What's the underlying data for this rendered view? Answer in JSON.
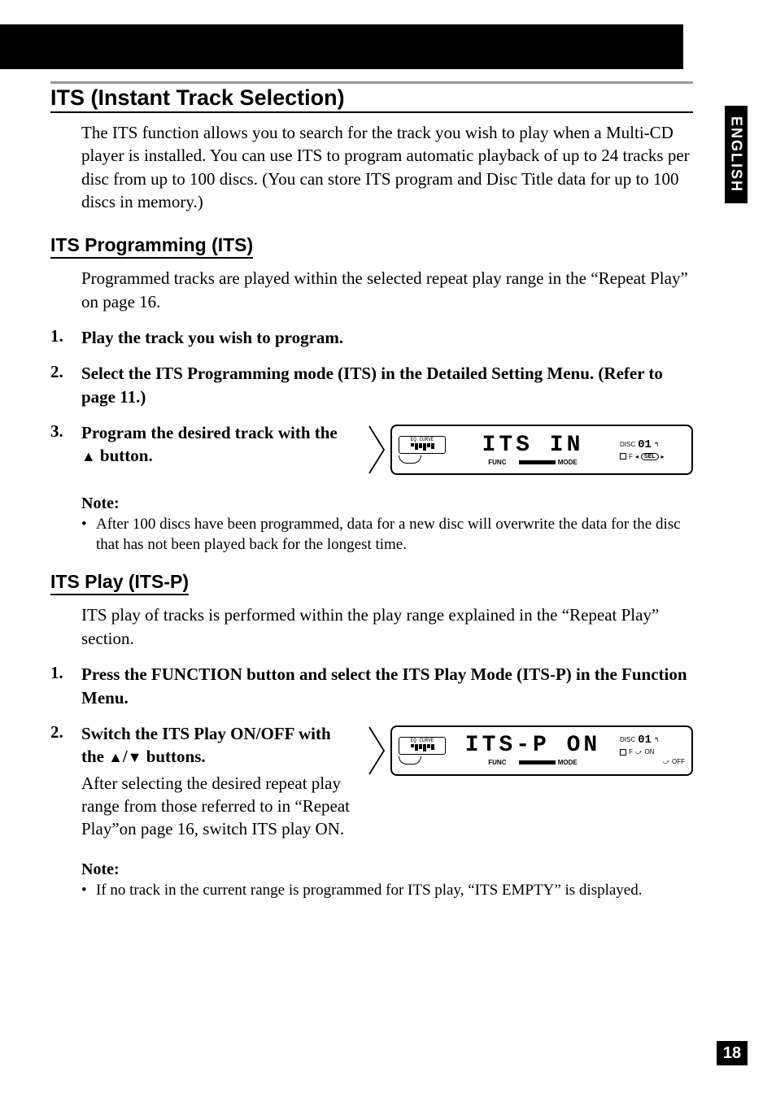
{
  "side_tab": "ENGLISH",
  "page_number": "18",
  "section_title": "ITS (Instant Track Selection)",
  "intro": "The ITS function allows you to search for the track you wish to play when a Multi-CD player is installed. You can use ITS to program automatic playback of up to 24 tracks per disc from up to 100 discs. (You can store ITS program and Disc Title data for up to 100 discs in memory.)",
  "subsection1": {
    "title": "ITS Programming (ITS)",
    "intro": "Programmed tracks are played within the selected repeat play range in the “Repeat Play” on page 16.",
    "steps": [
      {
        "num": "1.",
        "bold": "Play the track you wish to program."
      },
      {
        "num": "2.",
        "bold": "Select the ITS Programming mode (ITS) in the Detailed Setting Menu. (Refer to page 11.)"
      },
      {
        "num": "3.",
        "bold_pre": "Program the desired track with the ",
        "bold_post": " button."
      }
    ],
    "note_label": "Note:",
    "note_item": "After 100 discs have been programmed, data for a new disc will overwrite the data for the disc that has not been played back for the longest time."
  },
  "subsection2": {
    "title": "ITS Play (ITS-P)",
    "intro": "ITS play of tracks is performed within the play range explained in the “Repeat Play” section.",
    "steps": [
      {
        "num": "1.",
        "bold": "Press the FUNCTION button and select the ITS Play Mode (ITS-P) in the Function Menu."
      },
      {
        "num": "2.",
        "bold_pre": "Switch the ITS Play ON/OFF with the ",
        "bold_post": " buttons.",
        "plain": "After selecting the desired repeat play range from those referred to in “Repeat Play”on page 16, switch ITS play ON."
      }
    ],
    "note_label": "Note:",
    "note_item": "If no track in the current range is programmed for ITS play, “ITS EMPTY” is displayed."
  },
  "lcd1": {
    "eq_label": "EQ CURVE",
    "main": "ITS IN",
    "sub_func": "FUNC",
    "sub_mode": "MODE",
    "disc_label": "DISC",
    "disc_num": "01",
    "f_label": "F",
    "sel_label": "SEL"
  },
  "lcd2": {
    "eq_label": "EQ CURVE",
    "main": "ITS-P ON",
    "sub_func": "FUNC",
    "sub_mode": "MODE",
    "disc_label": "DISC",
    "disc_num": "01",
    "f_label": "F",
    "on_label": "ON",
    "off_label": "OFF"
  }
}
